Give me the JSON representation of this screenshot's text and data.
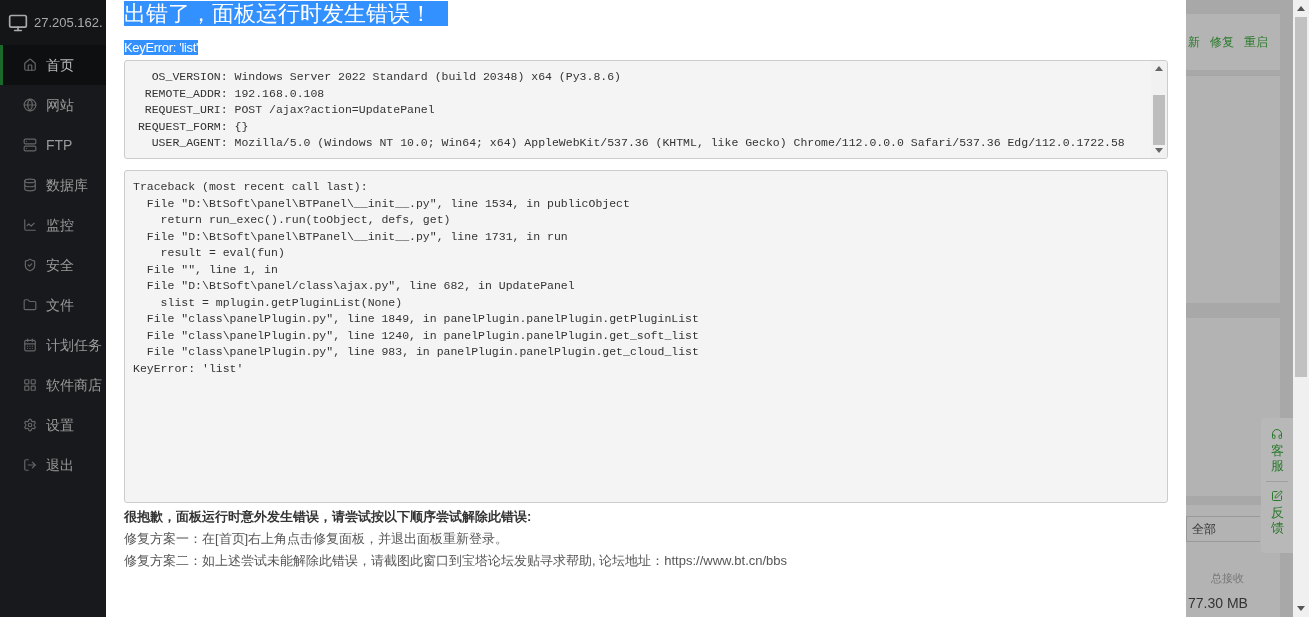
{
  "sidebar": {
    "host": "27.205.162.",
    "items": [
      {
        "label": "首页",
        "selected": true
      },
      {
        "label": "网站",
        "selected": false
      },
      {
        "label": "FTP",
        "selected": false
      },
      {
        "label": "数据库",
        "selected": false
      },
      {
        "label": "监控",
        "selected": false
      },
      {
        "label": "安全",
        "selected": false
      },
      {
        "label": "文件",
        "selected": false
      },
      {
        "label": "计划任务",
        "selected": false
      },
      {
        "label": "软件商店",
        "selected": false
      },
      {
        "label": "设置",
        "selected": false
      },
      {
        "label": "退出",
        "selected": false
      }
    ]
  },
  "dialog": {
    "title": "出错了，面板运行时发生错误！",
    "error": "KeyError: 'list'",
    "env_lines": [
      "   OS_VERSION: Windows Server 2022 Standard (build 20348) x64 (Py3.8.6)",
      "  REMOTE_ADDR: 192.168.0.108",
      "  REQUEST_URI: POST /ajax?action=UpdatePanel",
      " REQUEST_FORM: {}",
      "   USER_AGENT: Mozilla/5.0 (Windows NT 10.0; Win64; x64) AppleWebKit/537.36 (KHTML, like Gecko) Chrome/112.0.0.0 Safari/537.36 Edg/112.0.1722.58"
    ],
    "traceback": [
      "Traceback (most recent call last):",
      "  File \"D:\\BtSoft\\panel\\BTPanel\\__init__.py\", line 1534, in publicObject",
      "    return run_exec().run(toObject, defs, get)",
      "  File \"D:\\BtSoft\\panel\\BTPanel\\__init__.py\", line 1731, in run",
      "    result = eval(fun)",
      "  File \"\", line 1, in",
      "  File \"D:\\BtSoft\\panel/class\\ajax.py\", line 682, in UpdatePanel",
      "    slist = mplugin.getPluginList(None)",
      "  File \"class\\panelPlugin.py\", line 1849, in panelPlugin.panelPlugin.getPluginList",
      "  File \"class\\panelPlugin.py\", line 1240, in panelPlugin.panelPlugin.get_soft_list",
      "  File \"class\\panelPlugin.py\", line 983, in panelPlugin.panelPlugin.get_cloud_list",
      "KeyError: 'list'"
    ],
    "help_heading": "很抱歉，面板运行时意外发生错误，请尝试按以下顺序尝试解除此错误:",
    "help_lines": [
      "修复方案一：在[首页]右上角点击修复面板，并退出面板重新登录。",
      "修复方案二：如上述尝试未能解除此错误，请截图此窗口到宝塔论坛发贴寻求帮助, 论坛地址：https://www.bt.cn/bbs"
    ]
  },
  "background": {
    "top_links": [
      "新",
      "修复",
      "重启"
    ],
    "filter": "全部",
    "stat_label": "总接收",
    "stat_value": "77.30 MB"
  },
  "float_buttons": [
    "客服",
    "反馈"
  ]
}
